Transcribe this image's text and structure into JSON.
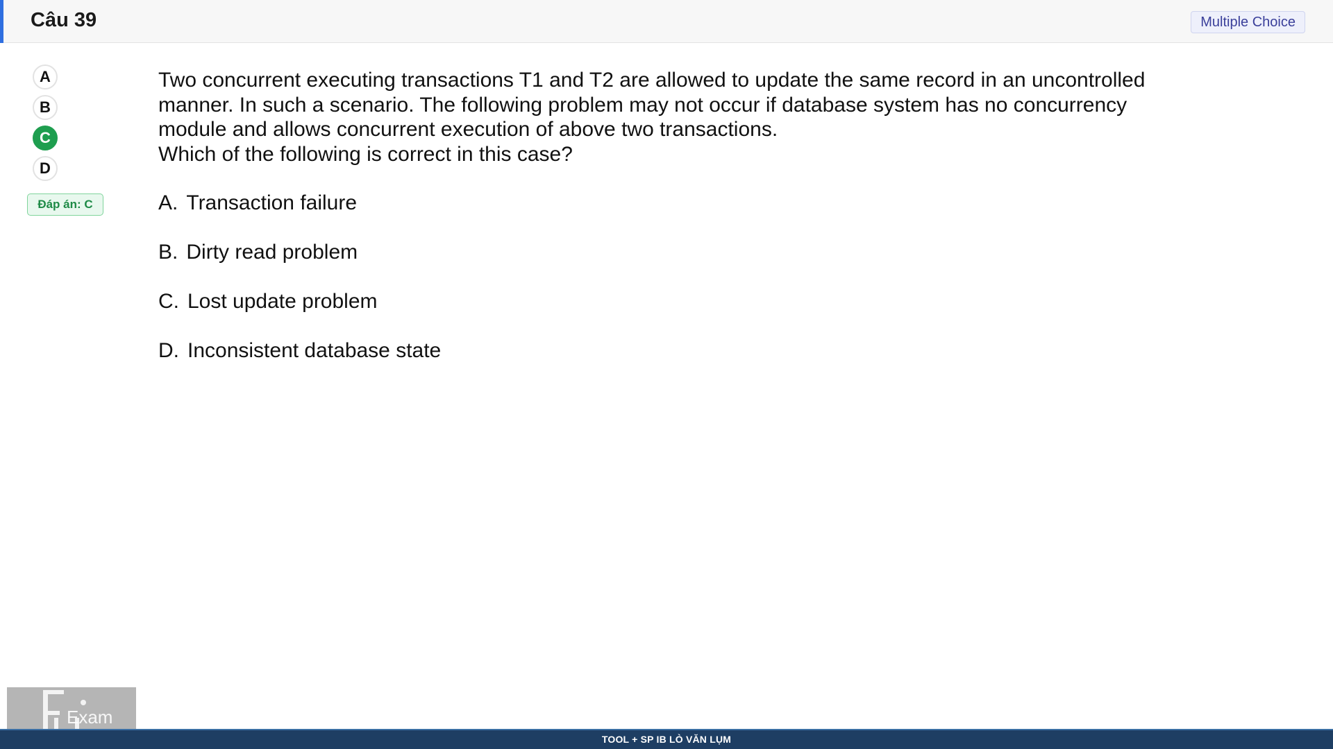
{
  "header": {
    "title": "Câu 39",
    "type_badge": "Multiple Choice",
    "accent_color": "#2f6fe0"
  },
  "answer_selector": {
    "options": [
      "A",
      "B",
      "C",
      "D"
    ],
    "selected": "C",
    "selected_color": "#1e9e4f",
    "answer_label": "Đáp án: C"
  },
  "question": {
    "lines": [
      "Two concurrent executing transactions T1 and T2 are allowed to update the same record in an uncontrolled",
      "manner. In such a scenario. The following problem may not occur if database system has no concurrency",
      "module and allows concurrent execution of above two transactions.",
      "Which of the following is correct in this case?"
    ]
  },
  "choices": [
    {
      "letter": "A.",
      "text": "Transaction failure"
    },
    {
      "letter": "B.",
      "text": "Dirty read problem"
    },
    {
      "letter": "C.",
      "text": "Lost update problem"
    },
    {
      "letter": "D.",
      "text": "Inconsistent database state"
    }
  ],
  "logo": {
    "icon": "fu-exam-logo",
    "text": "Exam"
  },
  "footer": {
    "text": "TOOL + SP IB LÒ VĂN LỤM",
    "color": "#1e3e63"
  }
}
